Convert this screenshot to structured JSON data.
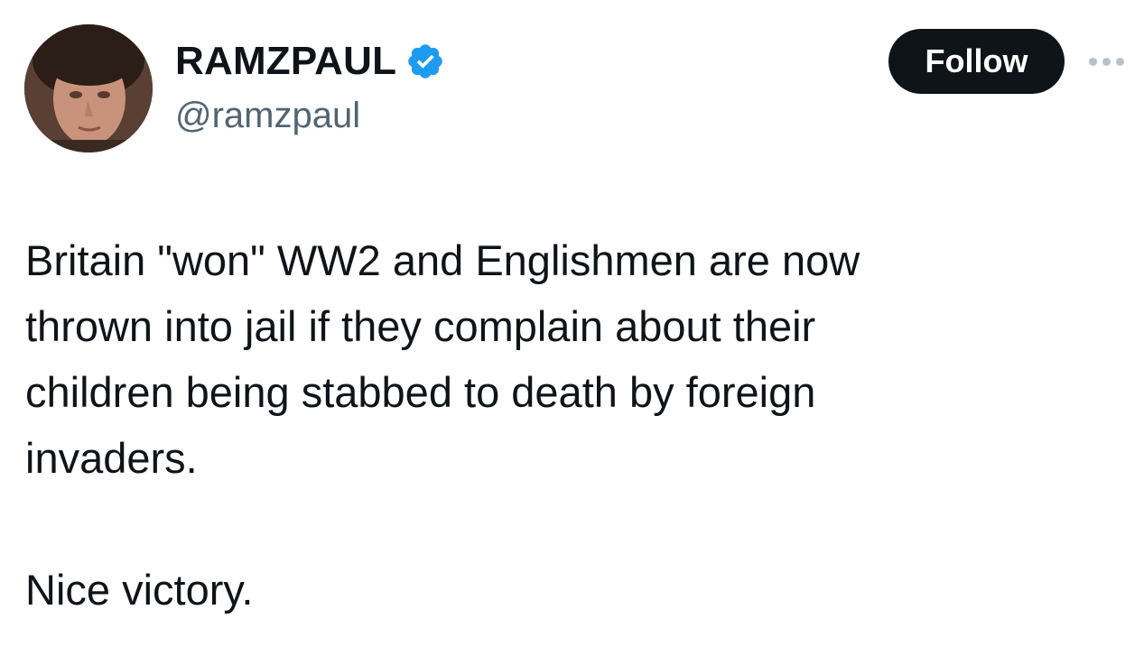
{
  "author": {
    "display_name": "RAMZPAUL",
    "handle": "@ramzpaul",
    "verified": true,
    "verified_icon": "verified-badge-icon",
    "verified_color": "#1d9bf0",
    "avatar_icon": "profile-photo"
  },
  "actions": {
    "follow_label": "Follow",
    "more_icon": "more-options-icon"
  },
  "tweet": {
    "paragraph1_lines": [
      "Britain \"won\" WW2 and Englishmen are now",
      "thrown into jail if they complain about their",
      "children being stabbed to death by foreign",
      "invaders."
    ],
    "paragraph2": "Nice victory."
  },
  "colors": {
    "text_primary": "#0f1419",
    "text_secondary": "#536471",
    "button_bg": "#0f1419",
    "button_text": "#ffffff"
  }
}
